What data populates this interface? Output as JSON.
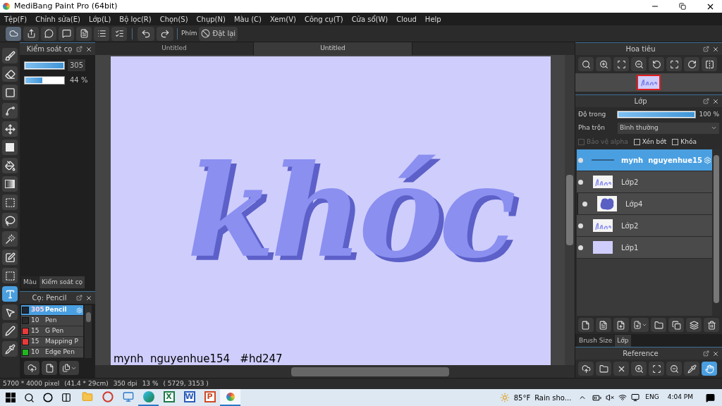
{
  "window": {
    "title": "MediBang Paint Pro (64bit)"
  },
  "menu": [
    "Tệp(F)",
    "Chỉnh sửa(E)",
    "Lớp(L)",
    "Bộ lọc(R)",
    "Chọn(S)",
    "Chụp(N)",
    "Màu (C)",
    "Xem(V)",
    "Công cụ(T)",
    "Cửa sổ(W)",
    "Cloud",
    "Help"
  ],
  "toolbar": {
    "shortcut_label": "Phím",
    "reset_button": "Đặt lại"
  },
  "tools": [
    {
      "kind": "brush",
      "selected": false
    },
    {
      "kind": "eraser",
      "selected": false
    },
    {
      "kind": "rect",
      "selected": false
    },
    {
      "kind": "polyline",
      "selected": false
    },
    {
      "kind": "move",
      "selected": false
    },
    {
      "kind": "fill-rect",
      "selected": false
    },
    {
      "kind": "bucket",
      "selected": false
    },
    {
      "kind": "gradient",
      "selected": false
    },
    {
      "kind": "select-rect",
      "selected": false
    },
    {
      "kind": "lasso",
      "selected": false
    },
    {
      "kind": "wand",
      "selected": false
    },
    {
      "kind": "select-pen",
      "selected": false
    },
    {
      "kind": "select-eraser",
      "selected": false
    },
    {
      "kind": "text",
      "selected": true
    },
    {
      "kind": "pointer",
      "selected": false
    },
    {
      "kind": "blur",
      "selected": false
    },
    {
      "kind": "eyedropper",
      "selected": false
    }
  ],
  "brush_control": {
    "title": "Kiểm soát cọ",
    "size": {
      "level": 1,
      "reading": "305"
    },
    "opacity": {
      "level": 0.44,
      "reading": "44 %"
    }
  },
  "left_tabs": [
    {
      "label": "Màu",
      "selected": false
    },
    {
      "label": "Kiểm soát cọ",
      "selected": true
    }
  ],
  "brush_panel": {
    "title": "Cọ: Pencil",
    "brushes": [
      {
        "color": "#1c2836",
        "size": "305",
        "name": "Pencil",
        "selected": true
      },
      {
        "color": "#2a2a2a",
        "size": "10",
        "name": "Pen",
        "selected": false
      },
      {
        "color": "#e83a3a",
        "size": "15",
        "name": "G Pen",
        "selected": false
      },
      {
        "color": "#e83a3a",
        "size": "15",
        "name": "Mapping P",
        "selected": false
      },
      {
        "color": "#22b422",
        "size": "10",
        "name": "Edge Pen",
        "selected": false
      }
    ]
  },
  "document_tabs": [
    {
      "label": "Untitled",
      "selected": false
    },
    {
      "label": "Untitled",
      "selected": true
    }
  ],
  "canvas": {
    "lettering": "khóc",
    "signature": "mynh  nguyenhue154   #hd247"
  },
  "navigator": {
    "title": "Hoa tiêu"
  },
  "layers_panel": {
    "title": "Lớp",
    "opacity_label": "Độ trong",
    "opacity": {
      "level": 1,
      "reading": "100 %"
    },
    "blend_label": "Pha trộn",
    "blend_value": "Bình thường",
    "options": [
      {
        "label": "Bảo vệ alpha",
        "checked": false,
        "disabled": true
      },
      {
        "label": "Xén bớt",
        "checked": false,
        "disabled": false
      },
      {
        "label": "Khóa",
        "checked": false,
        "disabled": false
      }
    ],
    "layers": [
      {
        "name": "mynh  nguyenhue15",
        "kind": "line",
        "selected": true,
        "clipped": false
      },
      {
        "name": "Lớp2",
        "kind": "lettering",
        "selected": false,
        "clipped": false
      },
      {
        "name": "Lớp4",
        "kind": "blob",
        "selected": false,
        "clipped": true
      },
      {
        "name": "Lớp2",
        "kind": "lettering",
        "selected": false,
        "clipped": false
      },
      {
        "name": "Lớp1",
        "kind": "fill",
        "selected": false,
        "clipped": false
      }
    ]
  },
  "bottom_tabs": [
    {
      "label": "Brush Size",
      "selected": false
    },
    {
      "label": "Lớp",
      "selected": true
    }
  ],
  "reference": {
    "title": "Reference",
    "tools": [
      {
        "kind": "cloud",
        "selected": false
      },
      {
        "kind": "folder",
        "selected": false
      },
      {
        "kind": "close",
        "selected": false
      },
      {
        "kind": "zoom-in",
        "selected": false
      },
      {
        "kind": "fit",
        "selected": false
      },
      {
        "kind": "zoom-out",
        "selected": false
      },
      {
        "kind": "eyedropper",
        "selected": false
      },
      {
        "kind": "hand",
        "selected": true
      }
    ]
  },
  "status_bar": [
    "5700 * 4000 pixel",
    "(41.4 * 29cm)",
    "350 dpi",
    "13 %",
    "( 5729, 3153 )"
  ],
  "taskbar": {
    "apps": [
      {
        "kind": "explorer",
        "running": false
      },
      {
        "kind": "ring",
        "running": false
      },
      {
        "kind": "monitor",
        "running": false
      },
      {
        "kind": "edge",
        "running": true
      },
      {
        "kind": "office",
        "glyph": "X",
        "color": "#1d7a45",
        "running": false
      },
      {
        "kind": "office",
        "glyph": "W",
        "color": "#2b5cb8",
        "running": false
      },
      {
        "kind": "office",
        "glyph": "P",
        "color": "#d04a24",
        "running": false
      },
      {
        "kind": "medibang",
        "running": true
      }
    ],
    "temperature": "85°F",
    "forecast": "Rain sho...",
    "language": "ENG",
    "time": "4:04 PM"
  }
}
